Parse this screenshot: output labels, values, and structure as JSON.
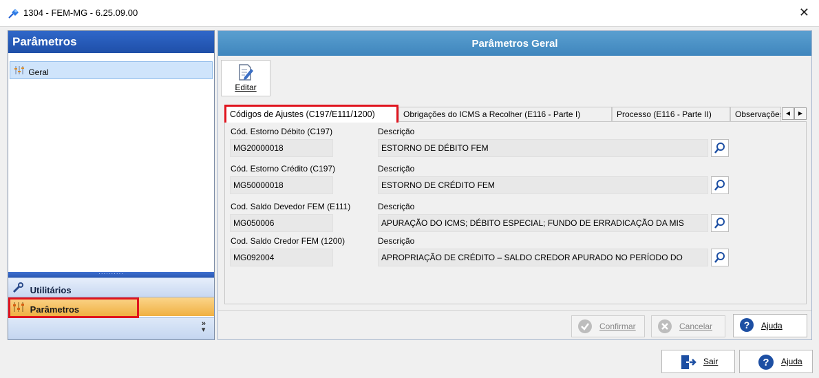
{
  "window": {
    "title": "1304 - FEM-MG - 6.25.09.00"
  },
  "left": {
    "header": "Parâmetros",
    "tree_items": [
      {
        "label": "Geral"
      }
    ],
    "nav": [
      {
        "label": "Utilitários"
      },
      {
        "label": "Parâmetros"
      }
    ]
  },
  "right": {
    "header": "Parâmetros Geral",
    "toolbar": {
      "edit_label": "Editar"
    },
    "tabs": [
      {
        "label": "Códigos de Ajustes (C197/E111/1200)"
      },
      {
        "label": "Obrigações do ICMS a Recolher (E116 - Parte I)"
      },
      {
        "label": "Processo (E116 - Parte II)"
      },
      {
        "label": "Observações"
      }
    ],
    "fields": [
      {
        "code_label": "Cód. Estorno Débito (C197)",
        "code": "MG20000018",
        "desc_label": "Descrição",
        "desc": "ESTORNO DE DÉBITO FEM"
      },
      {
        "code_label": "Cód. Estorno Crédito (C197)",
        "code": "MG50000018",
        "desc_label": "Descrição",
        "desc": "ESTORNO DE CRÉDITO FEM"
      },
      {
        "code_label": "Cod. Saldo Devedor FEM (E111)",
        "code": "MG050006",
        "desc_label": "Descrição",
        "desc": "APURAÇÃO DO ICMS; DÉBITO ESPECIAL; FUNDO DE ERRADICAÇÃO DA MIS"
      },
      {
        "code_label": "Cod. Saldo Credor FEM (1200)",
        "code": "MG092004",
        "desc_label": "Descrição",
        "desc": "APROPRIAÇÃO DE CRÉDITO – SALDO CREDOR APURADO NO PERÍODO DO"
      }
    ],
    "actions": {
      "confirm": "Confirmar",
      "cancel": "Cancelar",
      "help": "Ajuda"
    }
  },
  "footer": {
    "exit": "Sair",
    "help": "Ajuda"
  },
  "colors": {
    "accent": "#1f4fa8",
    "highlight": "#e0141e",
    "nav_selected": "#f0b042"
  }
}
